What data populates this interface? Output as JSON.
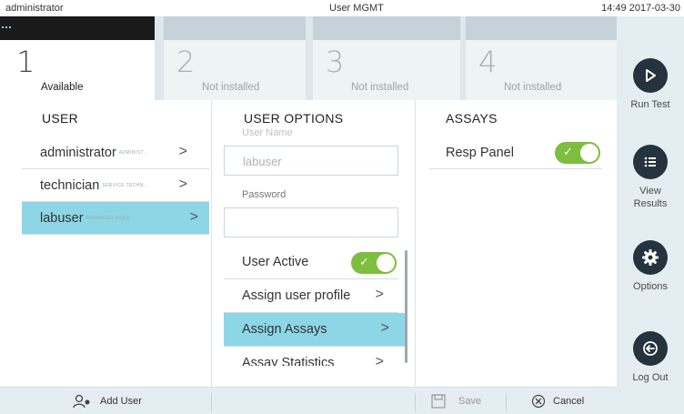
{
  "status_bar": {
    "user": "administrator",
    "title": "User MGMT",
    "datetime": "14:49 2017-03-30"
  },
  "modules": [
    {
      "number": "1",
      "label": "Available"
    },
    {
      "number": "2",
      "label": "Not installed"
    },
    {
      "number": "3",
      "label": "Not installed"
    },
    {
      "number": "4",
      "label": "Not installed"
    }
  ],
  "sidebar": {
    "run_test": "Run Test",
    "view_results": "View Results",
    "options": "Options",
    "log_out": "Log Out"
  },
  "users": {
    "heading": "USER",
    "items": [
      {
        "name": "administrator",
        "role": "ADMINIST…",
        "selected": false
      },
      {
        "name": "technician",
        "role": "SERVICE TECHN…",
        "selected": false
      },
      {
        "name": "labuser",
        "role": "ADVANCED USER",
        "selected": true
      }
    ]
  },
  "user_options": {
    "heading": "USER OPTIONS",
    "user_name_caption": "User Name",
    "user_name_value": "labuser",
    "password_caption": "Password",
    "password_value": "",
    "user_active_label": "User Active",
    "user_active": true,
    "items": [
      {
        "label": "Assign user profile",
        "selected": false
      },
      {
        "label": "Assign Assays",
        "selected": true
      },
      {
        "label": "Assay Statistics",
        "selected": false
      }
    ]
  },
  "assays": {
    "heading": "ASSAYS",
    "items": [
      {
        "name": "Resp Panel",
        "enabled": true
      }
    ]
  },
  "bottom_bar": {
    "add_user": "Add User",
    "save": "Save",
    "cancel": "Cancel"
  },
  "colors": {
    "accent_selected": "#8dd6e6",
    "toggle_on": "#7dbe3e",
    "icon_dark": "#24333e"
  },
  "icons": {
    "run_test": "play-icon",
    "view_results": "list-icon",
    "options": "gear-icon",
    "log_out": "logout-icon",
    "add_user": "add-user-icon",
    "save": "save-icon",
    "cancel": "cancel-icon"
  }
}
